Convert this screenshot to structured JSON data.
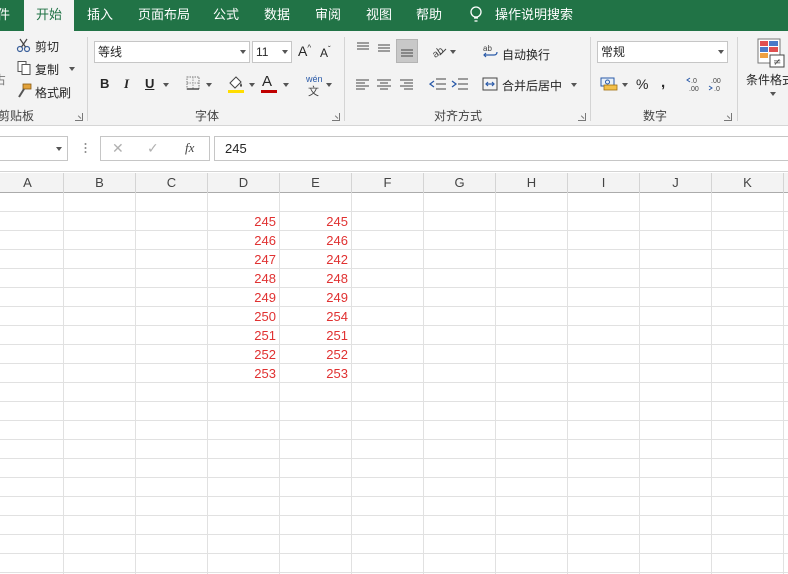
{
  "tabs": [
    {
      "label": "件",
      "active": false
    },
    {
      "label": "开始",
      "active": true
    },
    {
      "label": "插入",
      "active": false
    },
    {
      "label": "页面布局",
      "active": false
    },
    {
      "label": "公式",
      "active": false
    },
    {
      "label": "数据",
      "active": false
    },
    {
      "label": "审阅",
      "active": false
    },
    {
      "label": "视图",
      "active": false
    },
    {
      "label": "帮助",
      "active": false
    }
  ],
  "tell_me": "操作说明搜索",
  "clipboard": {
    "cut": "剪切",
    "copy": "复制",
    "format_painter": "格式刷",
    "group_label": "剪贴板",
    "paste_partial": "占"
  },
  "font": {
    "name": "等线",
    "size": "11",
    "bold": "B",
    "italic": "I",
    "underline": "U",
    "grow": "A",
    "shrink": "A",
    "font_color_letter": "A",
    "phonetic_top": "wén",
    "phonetic_bottom": "文",
    "group_label": "字体"
  },
  "alignment": {
    "wrap_text": "自动换行",
    "merge_center": "合并后居中",
    "group_label": "对齐方式"
  },
  "number": {
    "format": "常规",
    "percent": "%",
    "comma": ",",
    "group_label": "数字"
  },
  "styles": {
    "conditional_format": "条件格式"
  },
  "formula_bar": {
    "cancel": "✕",
    "enter": "✓",
    "fx": "fx",
    "value": "245"
  },
  "columns": [
    "A",
    "B",
    "C",
    "D",
    "E",
    "F",
    "G",
    "H",
    "I",
    "J",
    "K"
  ],
  "cells": {
    "D": [
      "245",
      "246",
      "247",
      "248",
      "249",
      "250",
      "251",
      "252",
      "253"
    ],
    "E": [
      "245",
      "246",
      "242",
      "248",
      "249",
      "254",
      "251",
      "252",
      "253"
    ]
  },
  "colors": {
    "brand": "#217346",
    "cell_text": "#e03131"
  }
}
